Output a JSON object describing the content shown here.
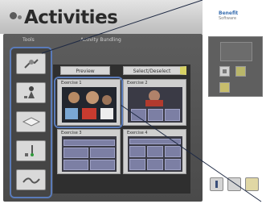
{
  "header": {
    "title": "Activities"
  },
  "labels": {
    "left": "Tools",
    "center": "Activity Bundling",
    "panel1": "Exercise 1",
    "panel2": "Exercise 2",
    "panel3": "Exercise 3",
    "panel4": "Exercise 4"
  },
  "tabs": [
    {
      "label": "Preview"
    },
    {
      "label": "Select/Deselect"
    }
  ],
  "brand": {
    "line1": "Benefit",
    "line2": "Software"
  },
  "sidebar": {
    "items": [
      {
        "icon": "hand-tool-icon"
      },
      {
        "icon": "figure-icon"
      },
      {
        "icon": "book-icon"
      },
      {
        "icon": "pen-icon"
      },
      {
        "icon": "wave-icon"
      }
    ]
  },
  "colors": {
    "highlight": "#5a7bb9",
    "frame": "#4f4f4f",
    "grid_cell": "#7c7fa4"
  }
}
